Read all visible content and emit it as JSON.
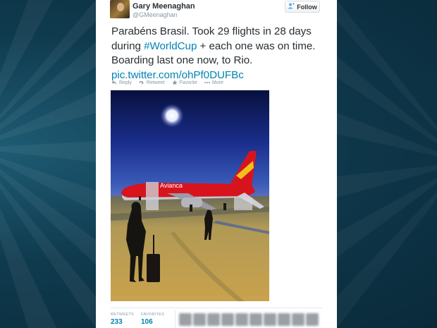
{
  "user": {
    "name": "Gary Meenaghan",
    "handle": "@GMeenaghan"
  },
  "follow": {
    "label": "Follow"
  },
  "tweet": {
    "part1": "Parabéns Brasil. Took 29 flights in 28 days during ",
    "hashtag": "#WorldCup",
    "part2": " + each one was on time. Boarding last one now, to Rio. ",
    "link": "pic.twitter.com/ohPf0DUFBc"
  },
  "actions": {
    "reply": "Reply",
    "retweet": "Retweet",
    "favorite": "Favorite",
    "more": "More"
  },
  "photo": {
    "tail_text": "Avianca"
  },
  "stats": {
    "retweets_label": "RETWEETS",
    "retweets_value": "233",
    "favorites_label": "FAVORITES",
    "favorites_value": "106"
  },
  "colors": {
    "link": "#0084b4",
    "follow_icon": "#55acee",
    "airline_red": "#d7141e"
  },
  "icons": [
    "follow-person-icon",
    "reply-icon",
    "retweet-icon",
    "favorite-star-icon",
    "more-dots-icon"
  ]
}
